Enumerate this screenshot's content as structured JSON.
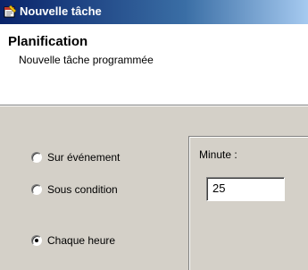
{
  "window": {
    "title": "Nouvelle tâche",
    "icon": "task-scheduler-icon"
  },
  "header": {
    "title": "Planification",
    "subtitle": "Nouvelle tâche programmée"
  },
  "trigger_options": [
    {
      "label": "Sur événement",
      "selected": false
    },
    {
      "label": "Sous condition",
      "selected": false
    },
    {
      "label": "Chaque heure",
      "selected": true
    }
  ],
  "minute": {
    "label": "Minute :",
    "value": "25"
  },
  "colors": {
    "titlebar_start": "#0a246a",
    "titlebar_end": "#a6caf0",
    "dialog_background": "#d4d0c8"
  }
}
